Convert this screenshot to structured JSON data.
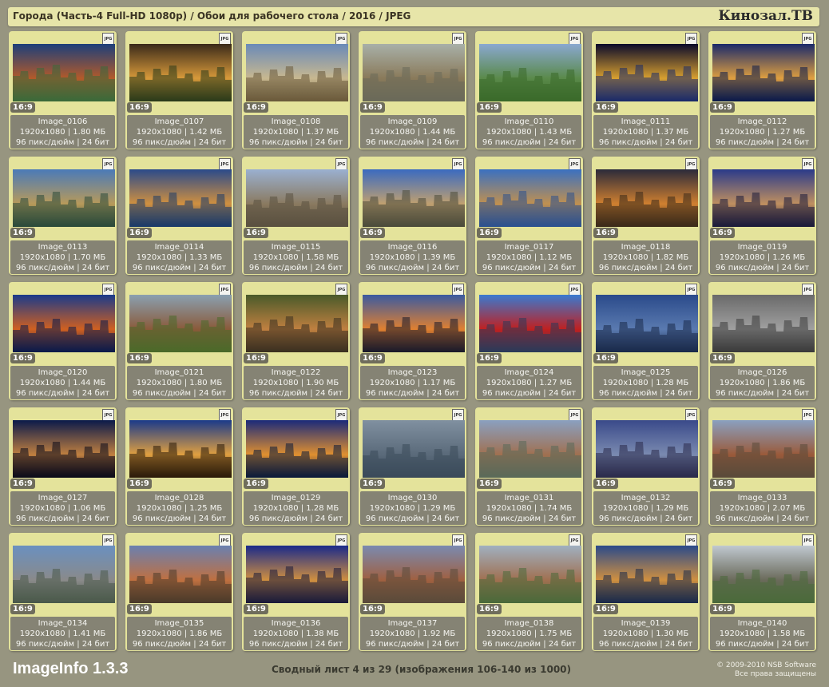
{
  "header": {
    "title": "Города (Часть-4 Full-HD 1080p) / Обои для рабочего стола / 2016 / JPEG",
    "brand": "Кинозал.TB"
  },
  "common": {
    "format_badge": "JPG",
    "ratio": "16:9",
    "dpi_bits": "96 пикс/дюйм | 24 бит"
  },
  "images": [
    {
      "name": "Image_0106",
      "info": "1920x1080 | 1.80 МБ",
      "colors": [
        "#1d3f7a",
        "#b35a2a",
        "#3a6a3a"
      ]
    },
    {
      "name": "Image_0107",
      "info": "1920x1080 | 1.42 МБ",
      "colors": [
        "#3a2a1a",
        "#d89a3a",
        "#2a3a1a"
      ]
    },
    {
      "name": "Image_0108",
      "info": "1920x1080 | 1.37 МБ",
      "colors": [
        "#6a8ab8",
        "#c8b890",
        "#6a5a3a"
      ]
    },
    {
      "name": "Image_0109",
      "info": "1920x1080 | 1.44 МБ",
      "colors": [
        "#a8b0a8",
        "#8a7a5a",
        "#6a6a5a"
      ]
    },
    {
      "name": "Image_0110",
      "info": "1920x1080 | 1.43 МБ",
      "colors": [
        "#8aa8d0",
        "#5a8a4a",
        "#3a6a2a"
      ]
    },
    {
      "name": "Image_0111",
      "info": "1920x1080 | 1.37 МБ",
      "colors": [
        "#0a0a2a",
        "#d8a030",
        "#1a2a6a"
      ]
    },
    {
      "name": "Image_0112",
      "info": "1920x1080 | 1.27 МБ",
      "colors": [
        "#1a2a6a",
        "#e0a040",
        "#0a1a4a"
      ]
    },
    {
      "name": "Image_0113",
      "info": "1920x1080 | 1.70 МБ",
      "colors": [
        "#4a7ab8",
        "#b89a5a",
        "#2a4a3a"
      ]
    },
    {
      "name": "Image_0114",
      "info": "1920x1080 | 1.33 МБ",
      "colors": [
        "#2a4a8a",
        "#d09040",
        "#1a3a6a"
      ]
    },
    {
      "name": "Image_0115",
      "info": "1920x1080 | 1.58 МБ",
      "colors": [
        "#9ab0d0",
        "#8a7a60",
        "#5a5040"
      ]
    },
    {
      "name": "Image_0116",
      "info": "1920x1080 | 1.39 МБ",
      "colors": [
        "#3a6ac0",
        "#c0a070",
        "#4a4a3a"
      ]
    },
    {
      "name": "Image_0117",
      "info": "1920x1080 | 1.12 МБ",
      "colors": [
        "#3a70c0",
        "#c09050",
        "#2a5090"
      ]
    },
    {
      "name": "Image_0118",
      "info": "1920x1080 | 1.82 МБ",
      "colors": [
        "#2a2a3a",
        "#d08030",
        "#3a2a1a"
      ]
    },
    {
      "name": "Image_0119",
      "info": "1920x1080 | 1.26 МБ",
      "colors": [
        "#2a3a8a",
        "#c09060",
        "#1a1a3a"
      ]
    },
    {
      "name": "Image_0120",
      "info": "1920x1080 | 1.44 МБ",
      "colors": [
        "#1a3a8a",
        "#d06020",
        "#0a1a4a"
      ]
    },
    {
      "name": "Image_0121",
      "info": "1920x1080 | 1.80 МБ",
      "colors": [
        "#8aa0b0",
        "#8a5a3a",
        "#4a6a2a"
      ]
    },
    {
      "name": "Image_0122",
      "info": "1920x1080 | 1.90 МБ",
      "colors": [
        "#4a5a2a",
        "#c08040",
        "#3a3020"
      ]
    },
    {
      "name": "Image_0123",
      "info": "1920x1080 | 1.17 МБ",
      "colors": [
        "#3a5aa0",
        "#e08030",
        "#1a1a2a"
      ]
    },
    {
      "name": "Image_0124",
      "info": "1920x1080 | 1.27 МБ",
      "colors": [
        "#3a7ad0",
        "#c02020",
        "#2a3a5a"
      ]
    },
    {
      "name": "Image_0125",
      "info": "1920x1080 | 1.28 МБ",
      "colors": [
        "#2a4a8a",
        "#5a7ab0",
        "#1a2a4a"
      ]
    },
    {
      "name": "Image_0126",
      "info": "1920x1080 | 1.86 МБ",
      "colors": [
        "#6a6a6a",
        "#a0a0a0",
        "#3a3a3a"
      ]
    },
    {
      "name": "Image_0127",
      "info": "1920x1080 | 1.06 МБ",
      "colors": [
        "#0a1a4a",
        "#c08040",
        "#0a0a1a"
      ]
    },
    {
      "name": "Image_0128",
      "info": "1920x1080 | 1.25 МБ",
      "colors": [
        "#1a3a8a",
        "#e0a040",
        "#2a1a0a"
      ]
    },
    {
      "name": "Image_0129",
      "info": "1920x1080 | 1.28 МБ",
      "colors": [
        "#1a2a7a",
        "#e09030",
        "#0a1a3a"
      ]
    },
    {
      "name": "Image_0130",
      "info": "1920x1080 | 1.29 МБ",
      "colors": [
        "#8090a0",
        "#5a6a7a",
        "#3a4a5a"
      ]
    },
    {
      "name": "Image_0131",
      "info": "1920x1080 | 1.74 МБ",
      "colors": [
        "#8aa0c0",
        "#a07050",
        "#5a6a5a"
      ]
    },
    {
      "name": "Image_0132",
      "info": "1920x1080 | 1.29 МБ",
      "colors": [
        "#3a4a8a",
        "#7a8ab0",
        "#2a2a4a"
      ]
    },
    {
      "name": "Image_0133",
      "info": "1920x1080 | 2.07 МБ",
      "colors": [
        "#8aa0c0",
        "#9a5a3a",
        "#5a4a3a"
      ]
    },
    {
      "name": "Image_0134",
      "info": "1920x1080 | 1.41 МБ",
      "colors": [
        "#6a90c0",
        "#8a8a8a",
        "#4a5a4a"
      ]
    },
    {
      "name": "Image_0135",
      "info": "1920x1080 | 1.86 МБ",
      "colors": [
        "#6a80b0",
        "#c07040",
        "#4a3a2a"
      ]
    },
    {
      "name": "Image_0136",
      "info": "1920x1080 | 1.38 МБ",
      "colors": [
        "#1a2a8a",
        "#d09040",
        "#1a1a3a"
      ]
    },
    {
      "name": "Image_0137",
      "info": "1920x1080 | 1.92 МБ",
      "colors": [
        "#7a8ab0",
        "#a06040",
        "#5a4a3a"
      ]
    },
    {
      "name": "Image_0138",
      "info": "1920x1080 | 1.75 МБ",
      "colors": [
        "#a0b0c0",
        "#a07050",
        "#4a6a3a"
      ]
    },
    {
      "name": "Image_0139",
      "info": "1920x1080 | 1.30 МБ",
      "colors": [
        "#2a4a8a",
        "#d09040",
        "#1a2a4a"
      ]
    },
    {
      "name": "Image_0140",
      "info": "1920x1080 | 1.58 МБ",
      "colors": [
        "#c0c8d0",
        "#6a6a5a",
        "#4a6a3a"
      ]
    }
  ],
  "footer": {
    "app": "ImageInfo 1.3.3",
    "page": "Сводный лист 4 из 29 (изображения 106-140 из 1000)",
    "copyright": "© 2009-2010 NSB Software",
    "rights": "Все права защищены"
  }
}
